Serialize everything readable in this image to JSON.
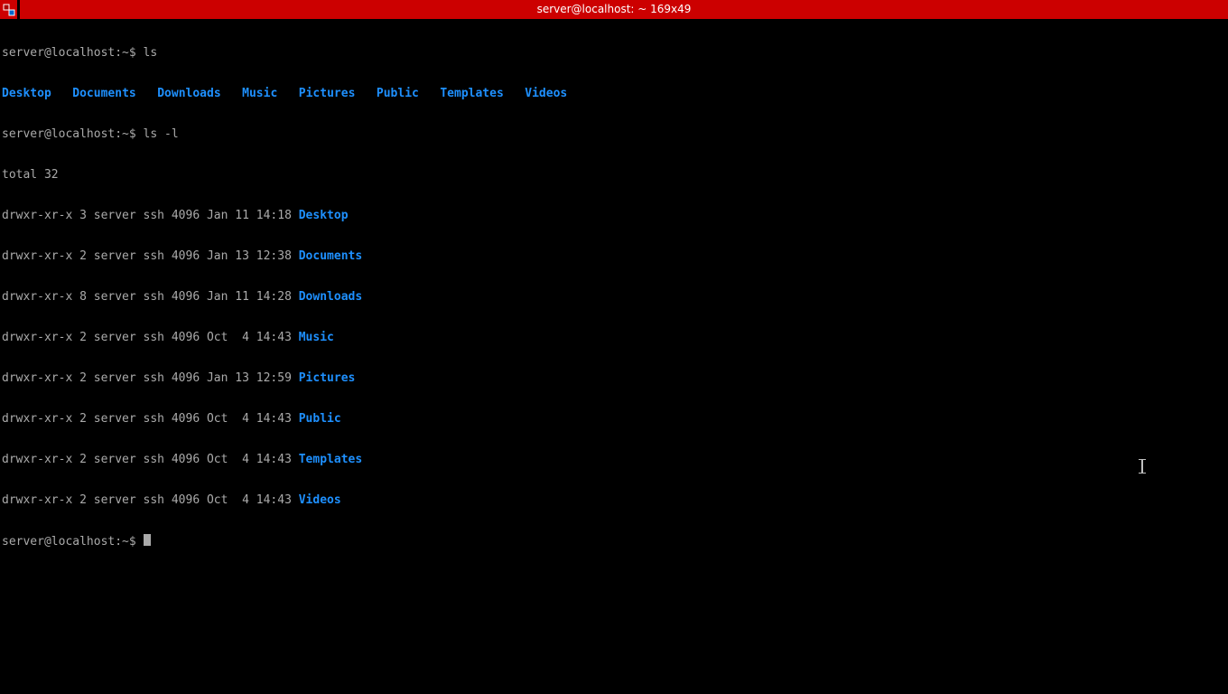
{
  "window": {
    "title": "server@localhost: ~ 169x49"
  },
  "session": {
    "prompt": "server@localhost:~$ ",
    "cmd1": "ls",
    "cmd2": "ls -l",
    "total_line": "total 32",
    "ls_short": [
      "Desktop",
      "Documents",
      "Downloads",
      "Music",
      "Pictures",
      "Public",
      "Templates",
      "Videos"
    ],
    "ls_long": [
      {
        "stat": "drwxr-xr-x 3 server ssh 4096 Jan 11 14:18 ",
        "name": "Desktop"
      },
      {
        "stat": "drwxr-xr-x 2 server ssh 4096 Jan 13 12:38 ",
        "name": "Documents"
      },
      {
        "stat": "drwxr-xr-x 8 server ssh 4096 Jan 11 14:28 ",
        "name": "Downloads"
      },
      {
        "stat": "drwxr-xr-x 2 server ssh 4096 Oct  4 14:43 ",
        "name": "Music"
      },
      {
        "stat": "drwxr-xr-x 2 server ssh 4096 Jan 13 12:59 ",
        "name": "Pictures"
      },
      {
        "stat": "drwxr-xr-x 2 server ssh 4096 Oct  4 14:43 ",
        "name": "Public"
      },
      {
        "stat": "drwxr-xr-x 2 server ssh 4096 Oct  4 14:43 ",
        "name": "Templates"
      },
      {
        "stat": "drwxr-xr-x 2 server ssh 4096 Oct  4 14:43 ",
        "name": "Videos"
      }
    ]
  }
}
